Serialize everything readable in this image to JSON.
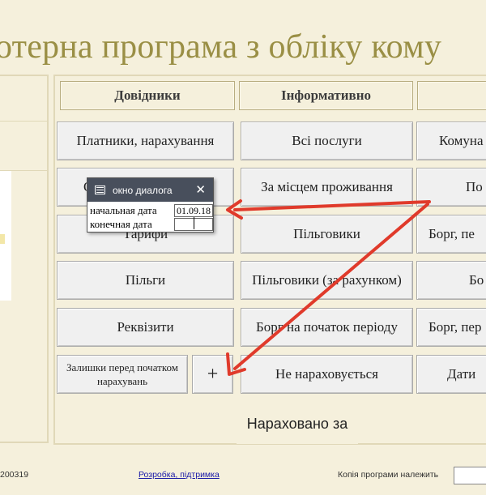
{
  "title": "отерна програма з обліку кому",
  "headers": [
    "Довідники",
    "Інформативно",
    ""
  ],
  "col1": [
    "Платники, нарахування",
    "О",
    "Тарифи",
    "Пільги",
    "Реквізити"
  ],
  "col1_bottom": {
    "balances": "Залишки перед початком нарахувань",
    "add": "+"
  },
  "col2": [
    "Всі послуги",
    "За місцем проживання",
    "Пільговики",
    "Пільговики (за рахунком)",
    "Борг на початок періоду",
    "Не нараховується"
  ],
  "col3": [
    "Комуна",
    "По",
    "Борг, пе",
    "Бо",
    "Борг, пер",
    "Дати"
  ],
  "nar": "Нараховано за",
  "footer": {
    "version": "200319",
    "link": "Розробка, підтримка",
    "owner_label": "Копія програми  належить"
  },
  "dialog": {
    "title": "окно диалога",
    "close": "✕",
    "start_label": "начальная дата",
    "start_value": "01.09.18",
    "end_label": "конечная дата",
    "end_value": ""
  },
  "colors": {
    "accent": "#e03a2b",
    "background": "#f5f0dc",
    "title": "#9a8f45"
  }
}
